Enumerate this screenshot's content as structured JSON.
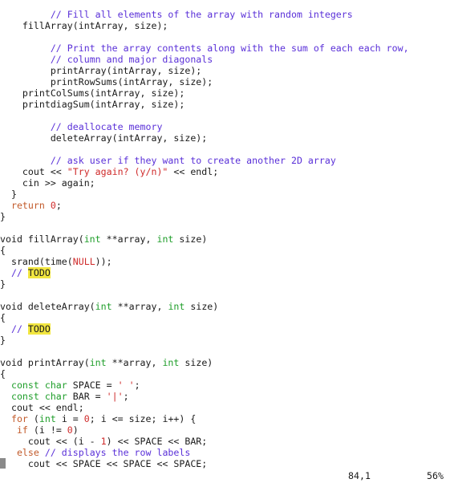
{
  "editor": {
    "colors": {
      "comment": "#5a30d8",
      "type": "#1f9e2a",
      "keyword": "#c25a2a",
      "string": "#cf2a2a",
      "number": "#cf2a2a",
      "todo_highlight": "#f2e640",
      "cursor": "#8a8a8a"
    },
    "lines": [
      [
        [
          "         ",
          ""
        ],
        [
          "// Fill all elements of the array with random integers",
          "cm"
        ]
      ],
      [
        [
          "    fillArray(intArray, size);",
          ""
        ]
      ],
      [],
      [
        [
          "         ",
          ""
        ],
        [
          "// Print the array contents along with the sum of each each row,",
          "cm"
        ]
      ],
      [
        [
          "         ",
          ""
        ],
        [
          "// column and major diagonals",
          "cm"
        ]
      ],
      [
        [
          "         printArray(intArray, size);",
          ""
        ]
      ],
      [
        [
          "         printRowSums(intArray, size);",
          ""
        ]
      ],
      [
        [
          "    printColSums(intArray, size);",
          ""
        ]
      ],
      [
        [
          "    printdiagSum(intArray, size);",
          ""
        ]
      ],
      [],
      [
        [
          "         ",
          ""
        ],
        [
          "// deallocate memory",
          "cm"
        ]
      ],
      [
        [
          "         deleteArray(intArray, size);",
          ""
        ]
      ],
      [],
      [
        [
          "         ",
          ""
        ],
        [
          "// ask user if they want to create another 2D array",
          "cm"
        ]
      ],
      [
        [
          "    cout << ",
          ""
        ],
        [
          "\"Try again? (y/n)\"",
          "st"
        ],
        [
          " << endl;",
          ""
        ]
      ],
      [
        [
          "    cin >> again;",
          ""
        ]
      ],
      [
        [
          "  }",
          ""
        ]
      ],
      [
        [
          "  ",
          ""
        ],
        [
          "return",
          "kw"
        ],
        [
          " ",
          ""
        ],
        [
          "0",
          "nu"
        ],
        [
          ";",
          ""
        ]
      ],
      [
        [
          "}",
          ""
        ]
      ],
      [],
      [
        [
          "void fillArray(",
          ""
        ],
        [
          "int",
          "ty"
        ],
        [
          " **array, ",
          ""
        ],
        [
          "int",
          "ty"
        ],
        [
          " size)",
          ""
        ]
      ],
      [
        [
          "{",
          ""
        ]
      ],
      [
        [
          "  srand(time(",
          ""
        ],
        [
          "NULL",
          "st"
        ],
        [
          "));",
          ""
        ]
      ],
      [
        [
          "  ",
          ""
        ],
        [
          "// ",
          "cm"
        ],
        [
          "TODO",
          "todo"
        ]
      ],
      [
        [
          "}",
          ""
        ]
      ],
      [],
      [
        [
          "void deleteArray(",
          ""
        ],
        [
          "int",
          "ty"
        ],
        [
          " **array, ",
          ""
        ],
        [
          "int",
          "ty"
        ],
        [
          " size)",
          ""
        ]
      ],
      [
        [
          "{",
          ""
        ]
      ],
      [
        [
          "  ",
          ""
        ],
        [
          "// ",
          "cm"
        ],
        [
          "TODO",
          "todo"
        ]
      ],
      [
        [
          "}",
          ""
        ]
      ],
      [],
      [
        [
          "void printArray(",
          ""
        ],
        [
          "int",
          "ty"
        ],
        [
          " **array, ",
          ""
        ],
        [
          "int",
          "ty"
        ],
        [
          " size)",
          ""
        ]
      ],
      [
        [
          "{",
          ""
        ]
      ],
      [
        [
          "  ",
          ""
        ],
        [
          "const char",
          "ty"
        ],
        [
          " SPACE = ",
          ""
        ],
        [
          "' '",
          "st"
        ],
        [
          ";",
          ""
        ]
      ],
      [
        [
          "  ",
          ""
        ],
        [
          "const char",
          "ty"
        ],
        [
          " BAR = ",
          ""
        ],
        [
          "'|'",
          "st"
        ],
        [
          ";",
          ""
        ]
      ],
      [
        [
          "  cout << endl;",
          ""
        ]
      ],
      [
        [
          "  ",
          ""
        ],
        [
          "for",
          "kw"
        ],
        [
          " (",
          ""
        ],
        [
          "int",
          "ty"
        ],
        [
          " i = ",
          ""
        ],
        [
          "0",
          "nu"
        ],
        [
          "; i <= size; i++) {",
          ""
        ]
      ],
      [
        [
          "   ",
          ""
        ],
        [
          "if",
          "kw"
        ],
        [
          " (i != ",
          ""
        ],
        [
          "0",
          "nu"
        ],
        [
          ")",
          ""
        ]
      ],
      [
        [
          "     cout << (i - ",
          ""
        ],
        [
          "1",
          "nu"
        ],
        [
          ") << SPACE << BAR;",
          ""
        ]
      ],
      [
        [
          "   ",
          ""
        ],
        [
          "else",
          "kw"
        ],
        [
          " ",
          ""
        ],
        [
          "// displays the row labels",
          "cm"
        ]
      ],
      [
        [
          "     cout << SPACE << SPACE << SPACE;",
          ""
        ]
      ]
    ]
  },
  "status": {
    "cursor_position": "84,1",
    "scroll_percent": "56%"
  }
}
